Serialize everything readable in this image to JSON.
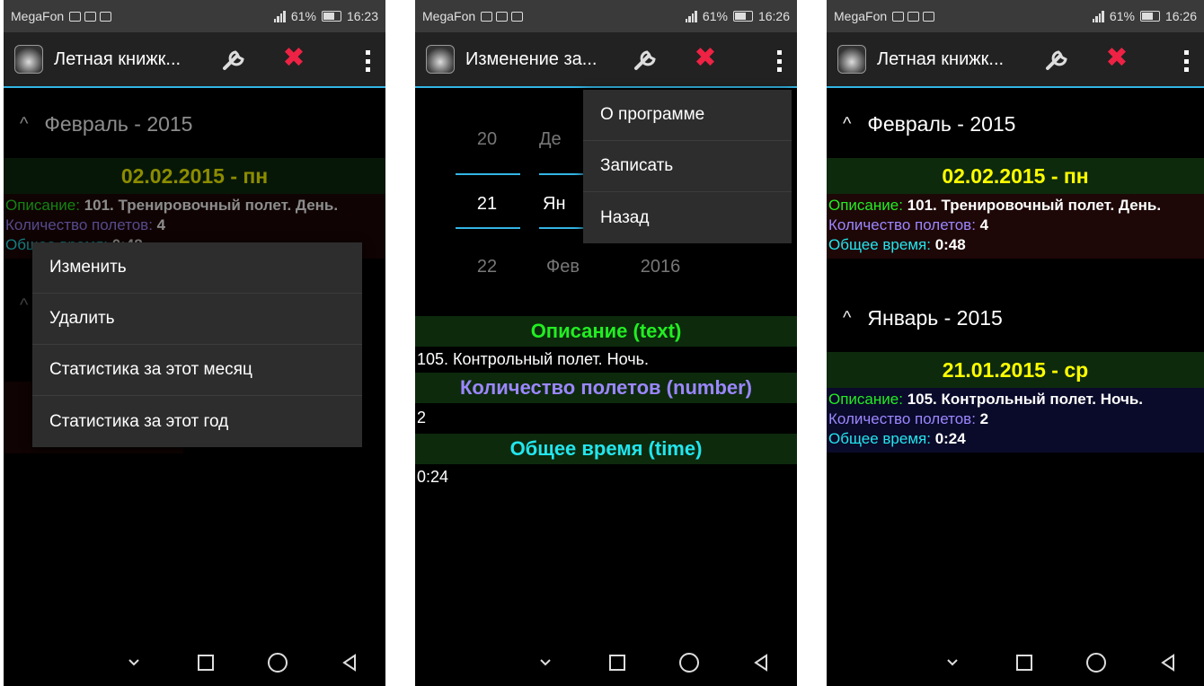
{
  "status": {
    "carrier": "MegaFon",
    "signal": "61%",
    "time_1": "16:23",
    "time_2": "16:26",
    "time_3": "16:26"
  },
  "screen1": {
    "title": "Летная книжк...",
    "group": "Февраль - 2015",
    "entry_date": "02.02.2015 - пн",
    "desc_label": "Описание:",
    "desc_value": "101. Тренировочный полет. День.",
    "count_label": "Количество полетов:",
    "count_value": "4",
    "time_label": "Общее время:",
    "time_value": "0:48",
    "menu": [
      "Изменить",
      "Удалить",
      "Статистика за этот месяц",
      "Статистика за этот год"
    ]
  },
  "screen2": {
    "title": "Изменение за...",
    "picker": {
      "day_prev": "20",
      "day_cur": "21",
      "day_next": "22",
      "month_prev": "Де",
      "month_cur": "Ян",
      "month_next": "Фев",
      "year_next": "2016"
    },
    "menu": [
      "О программе",
      "Записать",
      "Назад"
    ],
    "desc_title": "Описание (text)",
    "desc_value": "105. Контрольный полет. Ночь.",
    "count_title": "Количество полетов (number)",
    "count_value": "2",
    "time_title": "Общее время (time)",
    "time_value": "0:24"
  },
  "screen3": {
    "title": "Летная книжк...",
    "group1": "Февраль - 2015",
    "entry1": {
      "date": "02.02.2015 - пн",
      "desc_label": "Описание:",
      "desc_value": "101. Тренировочный полет. День.",
      "count_label": "Количество полетов:",
      "count_value": "4",
      "time_label": "Общее время:",
      "time_value": "0:48"
    },
    "group2": "Январь - 2015",
    "entry2": {
      "date": "21.01.2015 - ср",
      "desc_label": "Описание:",
      "desc_value": "105. Контрольный полет. Ночь.",
      "count_label": "Количество полетов:",
      "count_value": "2",
      "time_label": "Общее время:",
      "time_value": "0:24"
    }
  },
  "colors": {
    "accent": "#33b5e5",
    "date_yellow": "#ffff00",
    "label_green": "#22ee22",
    "label_violet": "#9b87ff",
    "label_cyan": "#22e6ee",
    "close_red": "#ee2244"
  },
  "icons": {
    "wrench": "wrench-icon",
    "close": "close-icon",
    "overflow": "overflow-menu-icon",
    "nav_hide": "chevron-down-icon",
    "nav_recent": "recent-apps-icon",
    "nav_home": "home-icon",
    "nav_back": "back-icon"
  }
}
